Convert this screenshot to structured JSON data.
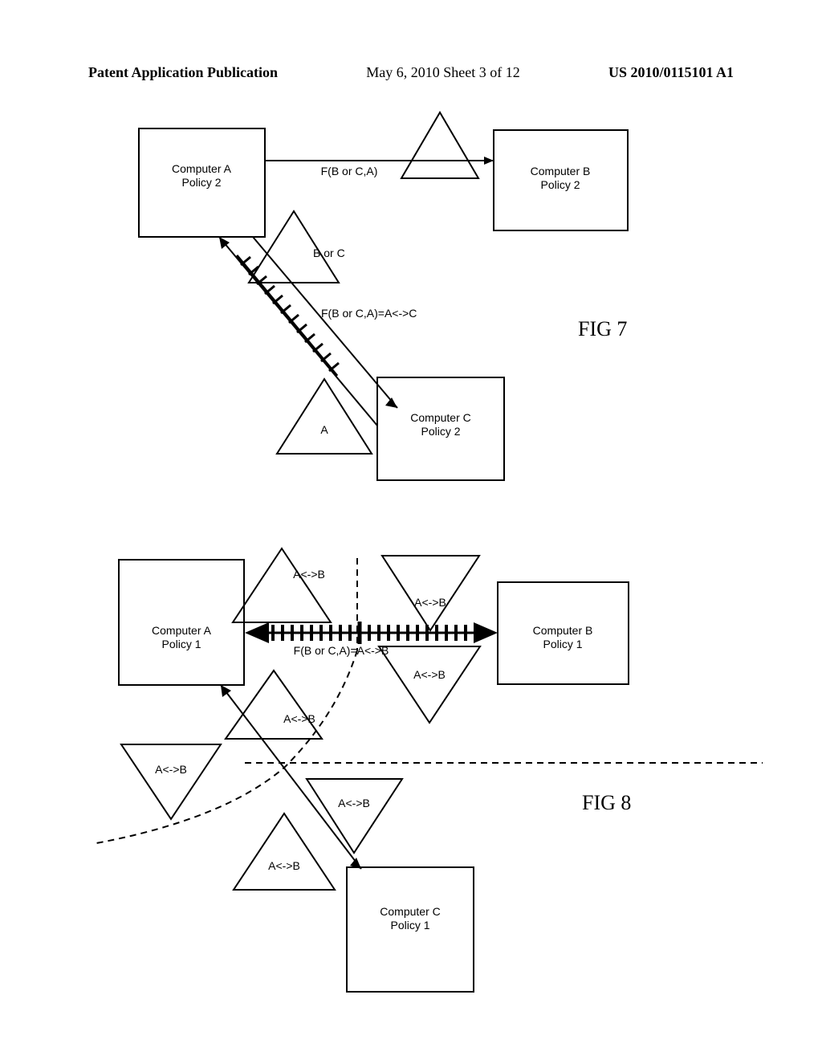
{
  "header": {
    "left": "Patent Application Publication",
    "center": "May 6, 2010  Sheet 3 of 12",
    "right": "US 2010/0115101 A1"
  },
  "fig7": {
    "label": "FIG 7",
    "computerA": {
      "line1": "Computer A",
      "line2": "Policy 2"
    },
    "computerB": {
      "line1": "Computer B",
      "line2": "Policy 2"
    },
    "computerC": {
      "line1": "Computer C",
      "line2": "Policy 2"
    },
    "edge_AB": "F(B or C,A)",
    "triangle_BorC": "B or C",
    "edge_AC": "F(B or C,A)=A<->C",
    "triangle_A": "A"
  },
  "fig8": {
    "label": "FIG 8",
    "computerA": {
      "line1": "Computer A",
      "line2": "Policy 1"
    },
    "computerB": {
      "line1": "Computer B",
      "line2": "Policy 1"
    },
    "computerC": {
      "line1": "Computer C",
      "line2": "Policy 1"
    },
    "edge_AB": "F(B or C,A)=A<->B",
    "tri_label": "A<->B"
  }
}
